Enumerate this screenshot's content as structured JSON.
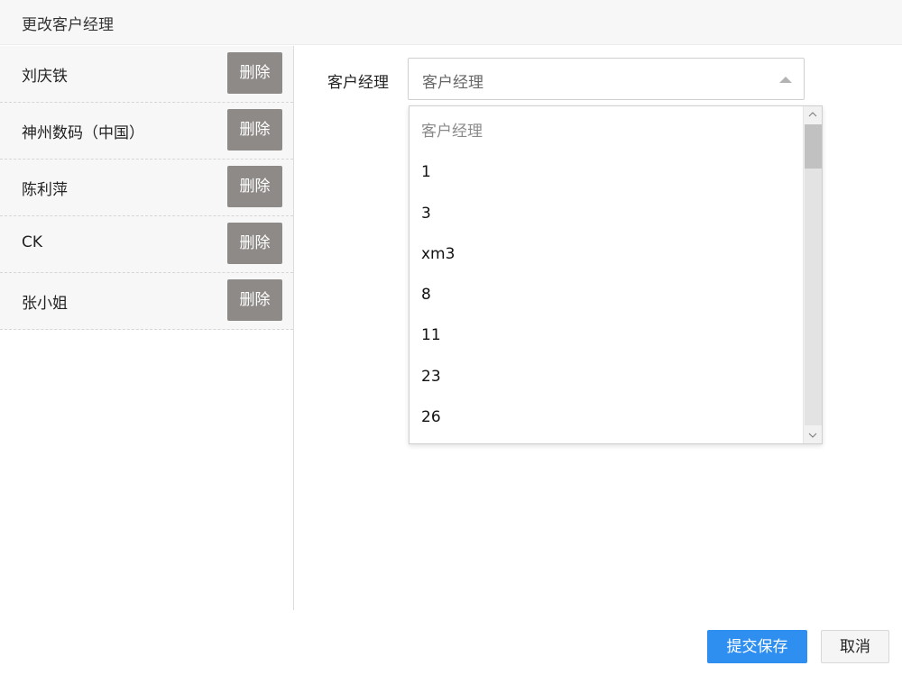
{
  "dialog": {
    "title": "更改客户经理"
  },
  "left_list": {
    "delete_label": "删除",
    "items": [
      {
        "name": "刘庆铁"
      },
      {
        "name": "神州数码（中国）"
      },
      {
        "name": "陈利萍"
      },
      {
        "name": "CK"
      },
      {
        "name": "张小姐"
      }
    ]
  },
  "form": {
    "label": "客户经理",
    "select_value": "客户经理",
    "options": [
      "客户经理",
      "1",
      "3",
      "xm3",
      "8",
      "11",
      "23",
      "26"
    ]
  },
  "footer": {
    "submit_label": "提交保存",
    "cancel_label": "取消"
  },
  "icons": {
    "scroll_up": "chevron-up-icon",
    "scroll_down": "chevron-down-icon",
    "select_caret": "caret-up-icon"
  },
  "colors": {
    "primary": "#2f8ff0",
    "delete_button": "#8e8a88"
  }
}
